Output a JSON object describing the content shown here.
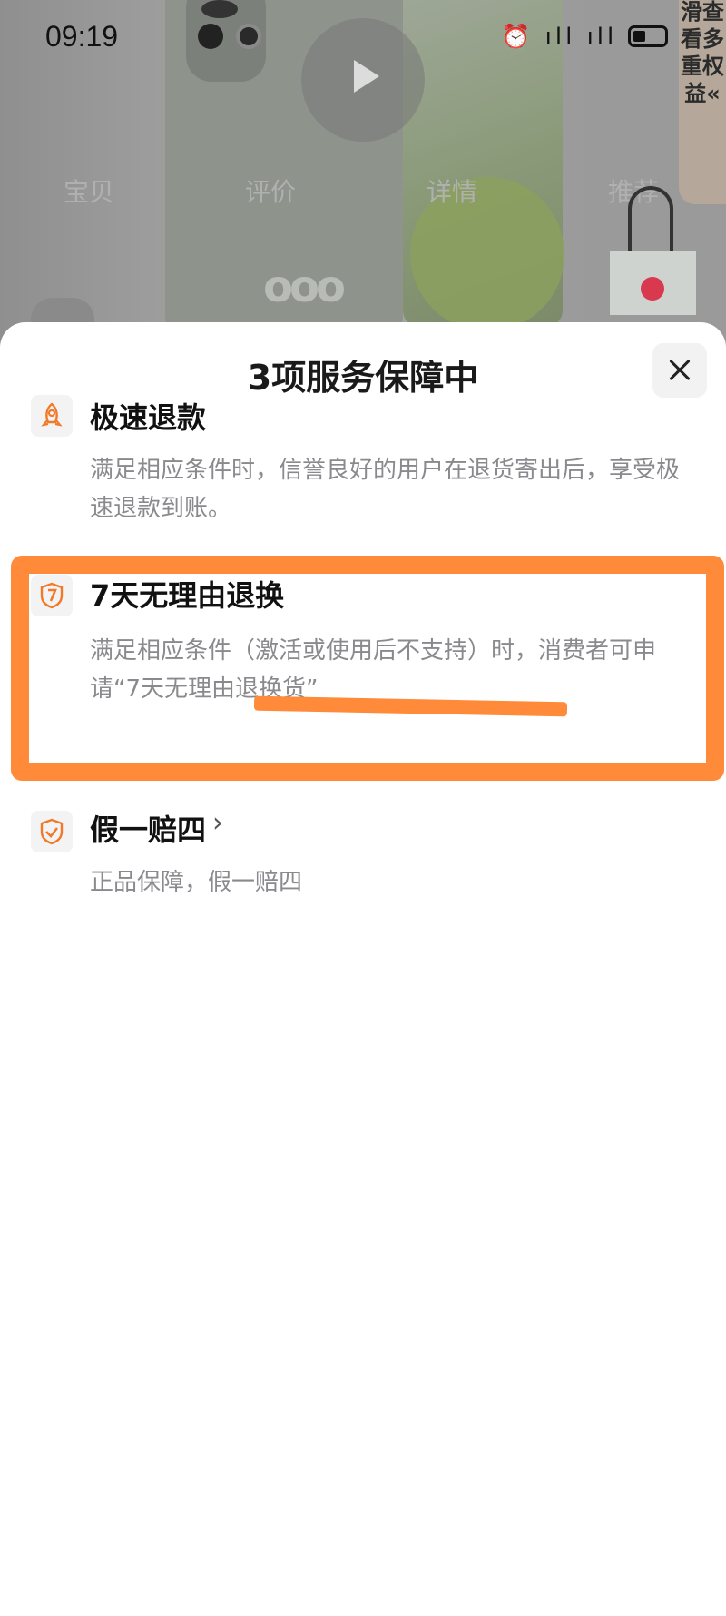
{
  "status_bar": {
    "time": "09:19",
    "icons": "⏰ ıll ıll"
  },
  "background": {
    "tabs": [
      "宝贝",
      "评价",
      "详情",
      "推荐"
    ],
    "side_banner": "滑查看多重权益«"
  },
  "sheet": {
    "title": "3项服务保障中",
    "items": [
      {
        "icon": "rocket-icon",
        "title": "极速退款",
        "desc": "满足相应条件时，信誉良好的用户在退货寄出后，享受极速退款到账。"
      },
      {
        "icon": "seven-days-icon",
        "title": "7天无理由退换",
        "desc": "满足相应条件（激活或使用后不支持）时，消费者可申请“7天无理由退换货”"
      },
      {
        "icon": "shield-check-icon",
        "title": "假一赔四",
        "desc": "正品保障，假一赔四",
        "chevron": "›"
      }
    ]
  },
  "colors": {
    "accent": "#ff8a3a",
    "icon_orange": "#f07a2a",
    "desc_gray": "#8a8a8e"
  }
}
